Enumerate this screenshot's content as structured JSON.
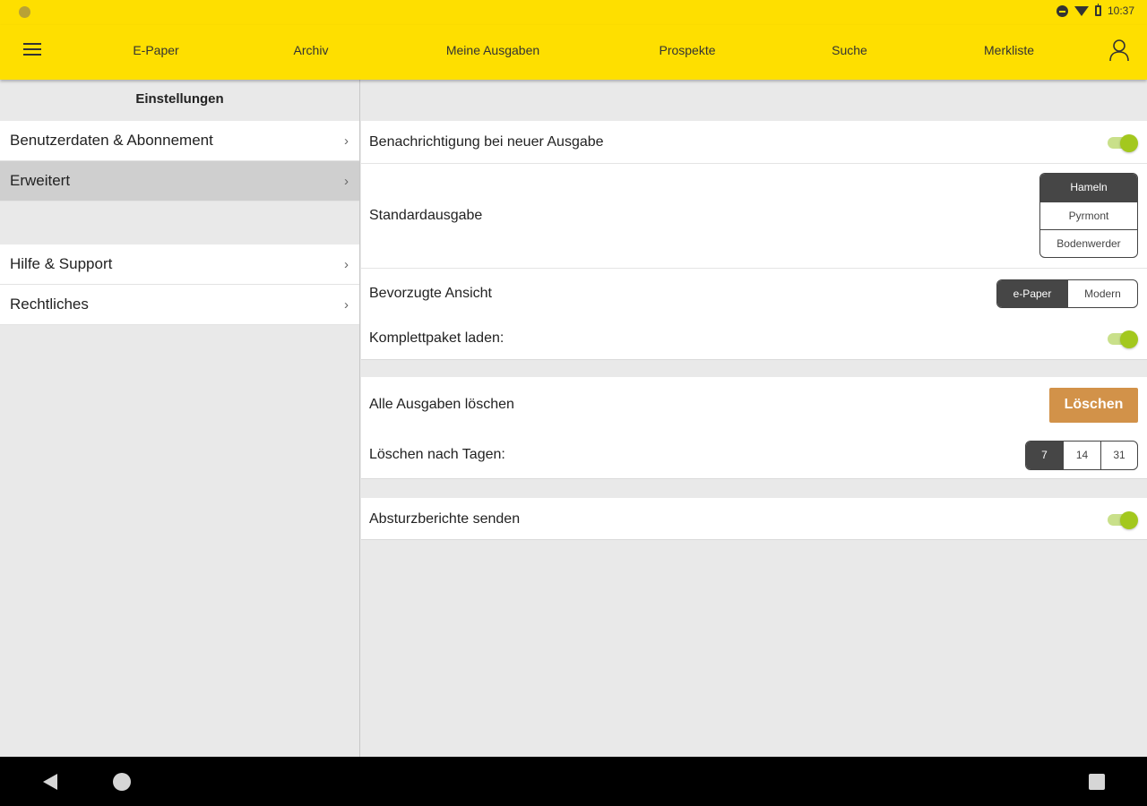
{
  "status_bar": {
    "time": "10:37"
  },
  "nav": {
    "items": [
      "E-Paper",
      "Archiv",
      "Meine Ausgaben",
      "Prospekte",
      "Suche",
      "Merkliste"
    ],
    "menu_icon": "hamburger-icon",
    "user_icon": "user-icon"
  },
  "sidebar": {
    "title": "Einstellungen",
    "group1": [
      {
        "label": "Benutzerdaten & Abonnement",
        "chevron": "›"
      },
      {
        "label": "Erweitert",
        "chevron": "›",
        "selected": true
      }
    ],
    "group2": [
      {
        "label": "Hilfe & Support",
        "chevron": "›"
      },
      {
        "label": "Rechtliches",
        "chevron": "›"
      }
    ]
  },
  "settings": {
    "notify_label": "Benachrichtigung bei neuer Ausgabe",
    "notify_on": true,
    "edition_label": "Standardausgabe",
    "edition_options": [
      "Hameln",
      "Pyrmont",
      "Bodenwerder"
    ],
    "edition_selected": "Hameln",
    "view_label": "Bevorzugte Ansicht",
    "view_options": [
      "e-Paper",
      "Modern"
    ],
    "view_selected": "e-Paper",
    "full_package_label": "Komplettpaket laden:",
    "full_package_on": true,
    "delete_all_label": "Alle Ausgaben löschen",
    "delete_button": "Löschen",
    "delete_after_label": "Löschen nach Tagen:",
    "delete_after_options": [
      "7",
      "14",
      "31"
    ],
    "delete_after_selected": "7",
    "crash_label": "Absturzberichte senden",
    "crash_on": true
  },
  "colors": {
    "brand_yellow": "#fedf00",
    "toggle_green": "#a3c81e",
    "delete_orange": "#d29249",
    "segment_dark": "#464646"
  }
}
